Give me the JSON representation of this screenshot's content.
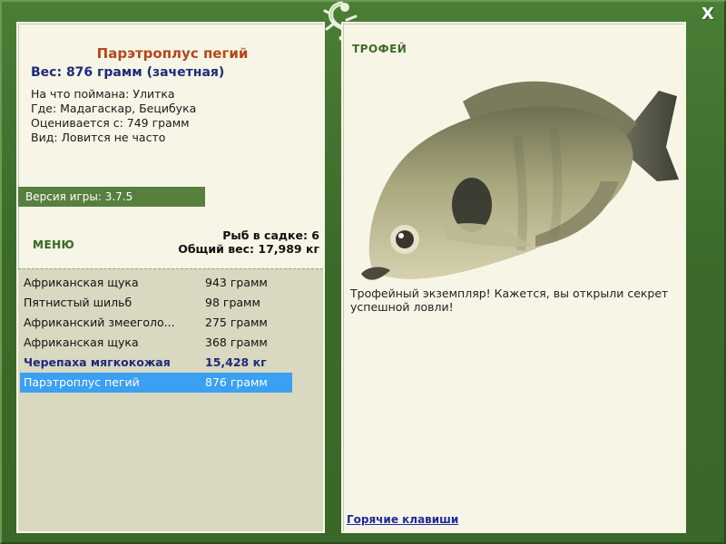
{
  "header": {
    "close_label": "X"
  },
  "catch": {
    "title": "Парэтроплус пегий",
    "weight_line": "Вес: 876 грамм (зачетная)",
    "bait": "На что поймана: Улитка",
    "location": "Где: Мадагаскар, Бецибука",
    "valued_from": "Оценивается с: 749 грамм",
    "frequency": "Вид: Ловится не часто"
  },
  "version": "Версия игры: 3.7.5",
  "menu_label": "МЕНЮ",
  "stats": {
    "fish_count": "Рыб в садке: 6",
    "total_weight": "Общий вес: 17,989 кг"
  },
  "fish_list": [
    {
      "name": "Африканская щука",
      "weight": "943 грамм",
      "style": "normal"
    },
    {
      "name": "Пятнистый шильб",
      "weight": "98 грамм",
      "style": "normal"
    },
    {
      "name": "Африканский змееголо...",
      "weight": "275 грамм",
      "style": "normal"
    },
    {
      "name": "Африканская щука",
      "weight": "368 грамм",
      "style": "normal"
    },
    {
      "name": "Черепаха мягкокожая",
      "weight": "15,428 кг",
      "style": "bold"
    },
    {
      "name": "Парэтроплус пегий",
      "weight": "876 грамм",
      "style": "selected"
    }
  ],
  "trophy": {
    "label": "ТРОФЕЙ",
    "description": "Трофейный экземпляр! Кажется, вы открыли секрет успешной ловли!"
  },
  "hotkeys_label": "Горячие клавиши",
  "colors": {
    "frame_green": "#3f6e2e",
    "panel_bg": "#f7f6e6",
    "list_bg": "#d9d8c0",
    "title_orange": "#b5461b",
    "accent_blue": "#1e2a7c",
    "selected_blue": "#3aa0f2"
  },
  "icons": {
    "logo": "lizard-logo-icon",
    "fish": "trophy-fish-image",
    "close": "close-icon"
  }
}
